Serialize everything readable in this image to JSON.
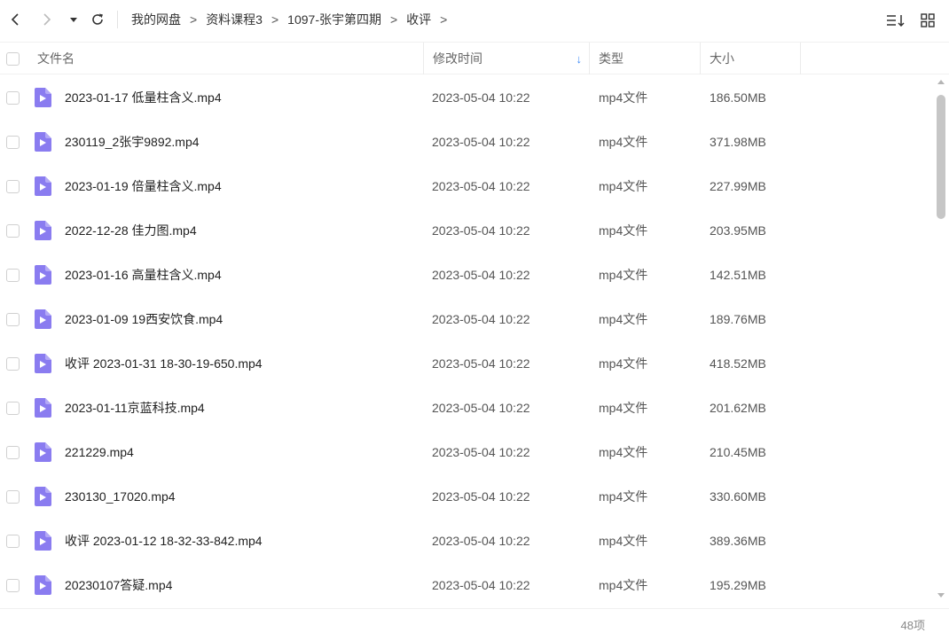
{
  "breadcrumb": [
    {
      "label": "我的网盘"
    },
    {
      "label": "资料课程3"
    },
    {
      "label": "1097-张宇第四期"
    },
    {
      "label": "收评"
    }
  ],
  "breadcrumb_separator": ">",
  "columns": {
    "name": "文件名",
    "modified": "修改时间",
    "type": "类型",
    "size": "大小"
  },
  "sort_indicator": "↓",
  "colors": {
    "accent": "#3d8af7",
    "video_icon": "#8a7cf0"
  },
  "files": [
    {
      "name": "2023-01-17 低量柱含义.mp4",
      "modified": "2023-05-04 10:22",
      "type": "mp4文件",
      "size": "186.50MB"
    },
    {
      "name": "230119_2张宇9892.mp4",
      "modified": "2023-05-04 10:22",
      "type": "mp4文件",
      "size": "371.98MB"
    },
    {
      "name": "2023-01-19 倍量柱含义.mp4",
      "modified": "2023-05-04 10:22",
      "type": "mp4文件",
      "size": "227.99MB"
    },
    {
      "name": "2022-12-28 佳力图.mp4",
      "modified": "2023-05-04 10:22",
      "type": "mp4文件",
      "size": "203.95MB"
    },
    {
      "name": "2023-01-16 高量柱含义.mp4",
      "modified": "2023-05-04 10:22",
      "type": "mp4文件",
      "size": "142.51MB"
    },
    {
      "name": "2023-01-09 19西安饮食.mp4",
      "modified": "2023-05-04 10:22",
      "type": "mp4文件",
      "size": "189.76MB"
    },
    {
      "name": "收评 2023-01-31 18-30-19-650.mp4",
      "modified": "2023-05-04 10:22",
      "type": "mp4文件",
      "size": "418.52MB"
    },
    {
      "name": "2023-01-11京蓝科技.mp4",
      "modified": "2023-05-04 10:22",
      "type": "mp4文件",
      "size": "201.62MB"
    },
    {
      "name": "221229.mp4",
      "modified": "2023-05-04 10:22",
      "type": "mp4文件",
      "size": "210.45MB"
    },
    {
      "name": "230130_17020.mp4",
      "modified": "2023-05-04 10:22",
      "type": "mp4文件",
      "size": "330.60MB"
    },
    {
      "name": "收评 2023-01-12 18-32-33-842.mp4",
      "modified": "2023-05-04 10:22",
      "type": "mp4文件",
      "size": "389.36MB"
    },
    {
      "name": "20230107答疑.mp4",
      "modified": "2023-05-04 10:22",
      "type": "mp4文件",
      "size": "195.29MB"
    }
  ],
  "item_count": "48项"
}
